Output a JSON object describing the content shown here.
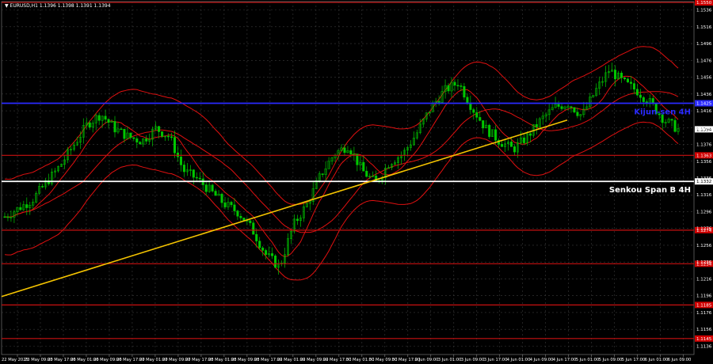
{
  "symbol_line": "▼ EURUSD,H1  1.1396  1.1398  1.1391  1.1394",
  "colors": {
    "background": "#000000",
    "grid": "#3a3a3a",
    "candles": "#00c800",
    "ichimoku": "#e01010",
    "support_levels": "#c81010",
    "kijun_line": "#2a2aff",
    "senkou_line": "#ffffff",
    "trendline": "#f5c400",
    "axis_text": "#ffffff",
    "level_label_bg": "#d00000",
    "current_label_bg": "#ffffff"
  },
  "chart_data": {
    "type": "candlestick",
    "symbol": "EURUSD",
    "timeframe": "H1",
    "ylim": [
      1.1126,
      1.1546
    ],
    "y_ticks": [
      "1.1136",
      "1.1156",
      "1.1176",
      "1.1196",
      "1.1216",
      "1.1236",
      "1.1256",
      "1.1276",
      "1.1296",
      "1.1316",
      "1.1336",
      "1.1356",
      "1.1376",
      "1.1396",
      "1.1416",
      "1.1436",
      "1.1456",
      "1.1476",
      "1.1496",
      "1.1516",
      "1.1536"
    ],
    "x_ticks": [
      "22 May 2025",
      "23 May 09:00",
      "23 May 17:00",
      "26 May 01:00",
      "26 May 09:00",
      "26 May 17:00",
      "27 May 01:00",
      "27 May 09:00",
      "27 May 17:00",
      "28 May 01:00",
      "28 May 09:00",
      "28 May 17:00",
      "29 May 01:00",
      "29 May 09:00",
      "29 May 17:00",
      "30 May 01:00",
      "30 May 09:00",
      "30 May 17:00",
      "2 Jun 09:00",
      "3 Jun 01:00",
      "3 Jun 09:00",
      "3 Jun 17:00",
      "4 Jun 01:00",
      "4 Jun 09:00",
      "4 Jun 17:00",
      "5 Jun 01:00",
      "5 Jun 09:00",
      "5 Jun 17:00",
      "6 Jun 01:00",
      "6 Jun 09:00"
    ],
    "current_price": "1.1394",
    "horizontal_levels": [
      {
        "value": 1.1545,
        "label": "1.1550",
        "kind": "support"
      },
      {
        "value": 1.1425,
        "label": "1.1425",
        "kind": "kijun",
        "name": "Kijun-sen 4H"
      },
      {
        "value": 1.1363,
        "label": "1.1363",
        "kind": "support"
      },
      {
        "value": 1.1332,
        "label": "1.1332",
        "kind": "senkou",
        "name": "Senkou Span B 4H"
      },
      {
        "value": 1.1274,
        "label": "1.1274",
        "kind": "support"
      },
      {
        "value": 1.1234,
        "label": "1.1234",
        "kind": "support"
      },
      {
        "value": 1.1185,
        "label": "1.1185",
        "kind": "support"
      },
      {
        "value": 1.1145,
        "label": "1.1145",
        "kind": "support"
      }
    ],
    "trendline": {
      "from": {
        "x": "22 May 2025",
        "y": 1.1195
      },
      "to": {
        "x": "6 Jun 09:00",
        "y": 1.1405
      }
    },
    "price_path": [
      1.129,
      1.13,
      1.131,
      1.133,
      1.135,
      1.1375,
      1.14,
      1.1412,
      1.1395,
      1.1385,
      1.138,
      1.1395,
      1.1385,
      1.1345,
      1.1335,
      1.132,
      1.1305,
      1.1295,
      1.1275,
      1.1245,
      1.123,
      1.128,
      1.1305,
      1.134,
      1.1365,
      1.1375,
      1.1345,
      1.133,
      1.1355,
      1.1365,
      1.139,
      1.142,
      1.144,
      1.145,
      1.142,
      1.1395,
      1.138,
      1.137,
      1.1385,
      1.1405,
      1.142,
      1.1425,
      1.141,
      1.144,
      1.1465,
      1.145,
      1.144,
      1.1425,
      1.1405,
      1.1394
    ]
  }
}
